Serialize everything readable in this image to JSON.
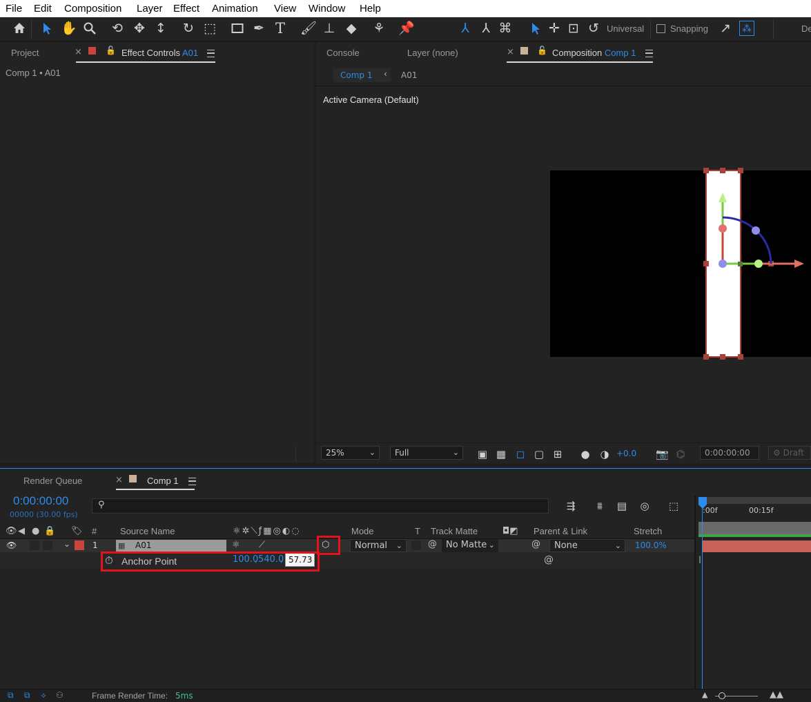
{
  "menu": [
    "File",
    "Edit",
    "Composition",
    "Layer",
    "Effect",
    "Animation",
    "View",
    "Window",
    "Help"
  ],
  "toolbar": {
    "universal_label": "Universal",
    "snapping_label": "Snapping",
    "workspace_label": "De"
  },
  "left_panel": {
    "tab_project": "Project",
    "tab_effect_controls": "Effect Controls",
    "tab_effect_controls_layer": "A01",
    "breadcrumb": "Comp 1 • A01"
  },
  "right_panel": {
    "tab_console": "Console",
    "tab_layer": "Layer (none)",
    "tab_composition": "Composition",
    "tab_composition_name": "Comp 1",
    "subtab_comp": "Comp 1",
    "subtab_layer": "A01",
    "camera_label": "Active Camera (Default)",
    "zoom": "25%",
    "resolution": "Full",
    "exposure": "+0.0",
    "timecode": "0:00:00:00",
    "draft_label": "Draft"
  },
  "timeline": {
    "tab_render_queue": "Render Queue",
    "tab_comp": "Comp 1",
    "current_time": "0:00:00:00",
    "frame_info": "00000 (30.00 fps)",
    "search_placeholder": "",
    "headers": {
      "num": "#",
      "source_name": "Source Name",
      "mode": "Mode",
      "t": "T",
      "track_matte": "Track Matte",
      "parent_link": "Parent & Link",
      "stretch": "Stretch"
    },
    "ruler_start": ":00f",
    "ruler_mark": "00:15f",
    "layer": {
      "index": "1",
      "name": "A01",
      "mode": "Normal",
      "track_matte": "No Matte",
      "parent": "None",
      "stretch": "100.0%"
    },
    "property": {
      "name": "Anchor Point",
      "value_x": "100.0",
      "value_y": "540.0",
      "value_z_edit": "57.73"
    },
    "status_label": "Frame Render Time:",
    "status_value": "5ms"
  },
  "colors": {
    "accent_blue": "#2d8ceb",
    "layer_label_red": "#c9463d",
    "highlight_red": "#e3121b",
    "comp_swatch_tan": "#c8b295"
  }
}
